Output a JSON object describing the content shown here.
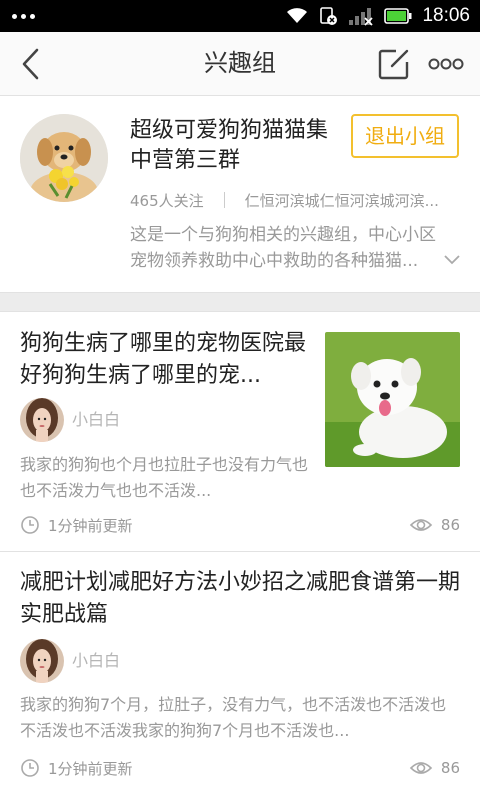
{
  "status_bar": {
    "time": "18:06"
  },
  "header": {
    "title": "兴趣组"
  },
  "group": {
    "name": "超级可爱狗狗猫猫集中营第三群",
    "exit_label": "退出小组",
    "followers": "465人关注",
    "location": "仁恒河滨城仁恒河滨城河滨...",
    "description": "这是一个与狗狗相关的兴趣组，中心小区宠物领养救助中心中救助的各种猫猫..."
  },
  "posts": [
    {
      "title": "狗狗生病了哪里的宠物医院最好狗狗生病了哪里的宠...",
      "author": "小白白",
      "excerpt": "我家的狗狗也个月也拉肚子也没有力气也也不活泼力气也也不活泼...",
      "time": "1分钟前更新",
      "views": "86"
    },
    {
      "title": "减肥计划减肥好方法小妙招之减肥食谱第一期实肥战篇",
      "author": "小白白",
      "excerpt": "我家的狗狗7个月，拉肚子，没有力气，也不活泼也不活泼也不活泼也不活泼我家的狗狗7个月也不活泼也...",
      "time": "1分钟前更新",
      "views": "86"
    }
  ],
  "icons": {
    "accent_color": "#f3c02e",
    "battery_color": "#4cd137"
  }
}
